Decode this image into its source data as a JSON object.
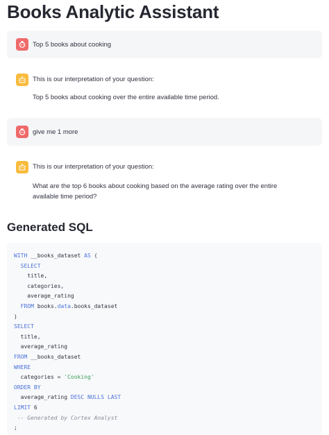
{
  "app": {
    "title": "Books Analytic Assistant"
  },
  "messages": [
    {
      "role": "user",
      "avatar_icon": "bot-face-icon",
      "text": "Top 5 books about cooking"
    },
    {
      "role": "assistant",
      "avatar_icon": "robot-icon",
      "intro": "This is our interpretation of your question:",
      "interpretation": "Top 5 books about cooking over the entire available time period."
    },
    {
      "role": "user",
      "avatar_icon": "bot-face-icon",
      "text": "give me 1 more"
    },
    {
      "role": "assistant",
      "avatar_icon": "robot-icon",
      "intro": "This is our interpretation of your question:",
      "interpretation": "What are the top 6 books about cooking based on the average rating over the entire available time period?"
    }
  ],
  "sql_section": {
    "heading": "Generated SQL",
    "lines": [
      [
        {
          "t": "WITH",
          "c": "kw"
        },
        {
          "t": " __books_dataset "
        },
        {
          "t": "AS",
          "c": "kw"
        },
        {
          "t": " ("
        }
      ],
      [
        {
          "t": "  "
        },
        {
          "t": "SELECT",
          "c": "kw"
        }
      ],
      [
        {
          "t": "    title,"
        }
      ],
      [
        {
          "t": "    categories,"
        }
      ],
      [
        {
          "t": "    average_rating"
        }
      ],
      [
        {
          "t": "  "
        },
        {
          "t": "FROM",
          "c": "kw"
        },
        {
          "t": " books."
        },
        {
          "t": "data",
          "c": "kw"
        },
        {
          "t": ".books_dataset"
        }
      ],
      [
        {
          "t": ")"
        }
      ],
      [
        {
          "t": "SELECT",
          "c": "kw"
        }
      ],
      [
        {
          "t": "  title,"
        }
      ],
      [
        {
          "t": "  average_rating"
        }
      ],
      [
        {
          "t": "FROM",
          "c": "kw"
        },
        {
          "t": " __books_dataset"
        }
      ],
      [
        {
          "t": "WHERE",
          "c": "kw"
        }
      ],
      [
        {
          "t": "  categories = "
        },
        {
          "t": "'Cooking'",
          "c": "str"
        }
      ],
      [
        {
          "t": "ORDER BY",
          "c": "kw"
        }
      ],
      [
        {
          "t": "  average_rating "
        },
        {
          "t": "DESC",
          "c": "kw"
        },
        {
          "t": " "
        },
        {
          "t": "NULLS",
          "c": "kw"
        },
        {
          "t": " "
        },
        {
          "t": "LAST",
          "c": "kw"
        }
      ],
      [
        {
          "t": "LIMIT",
          "c": "kw"
        },
        {
          "t": " 6"
        }
      ],
      [
        {
          "t": " "
        },
        {
          "t": "-- Generated by Cortex Analyst",
          "c": "cm"
        }
      ],
      [
        {
          "t": ";"
        }
      ]
    ]
  },
  "colors": {
    "user_avatar": "#ef6a6a",
    "assistant_avatar": "#f8bb3c",
    "sql_keyword": "#4a72d8",
    "sql_string": "#3c9f5a",
    "sql_comment": "#8a8d98"
  }
}
